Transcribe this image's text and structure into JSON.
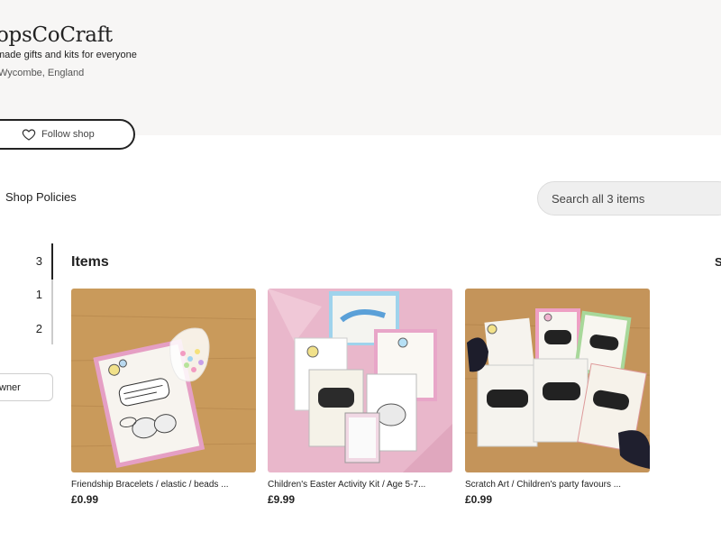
{
  "shop": {
    "name": "opsCoCraft",
    "tagline": "made gifts and kits for everyone",
    "location": "Wycombe, England",
    "follow_label": "Follow shop"
  },
  "nav": {
    "policies_label": "Shop Policies",
    "search_placeholder": "Search all 3 items",
    "contact_owner_label": "wner"
  },
  "sidebar": {
    "counts": [
      "3",
      "1",
      "2"
    ]
  },
  "items_section": {
    "title": "Items",
    "sort_partial": "S"
  },
  "listings": [
    {
      "title": "Friendship Bracelets / elastic / beads ...",
      "price": "£0.99",
      "image": "friendship-bracelet-card-photo"
    },
    {
      "title": "Children's Easter Activity Kit / Age 5-7...",
      "price": "£9.99",
      "image": "easter-activity-kit-photo"
    },
    {
      "title": "Scratch Art / Children's party favours ...",
      "price": "£0.99",
      "image": "scratch-art-cards-photo"
    }
  ],
  "colors": {
    "header_band": "#f7f6f5",
    "wood": "#c99a5b",
    "card_pink": "#e6a3c2",
    "tissue_pink": "#e9b7cb"
  }
}
